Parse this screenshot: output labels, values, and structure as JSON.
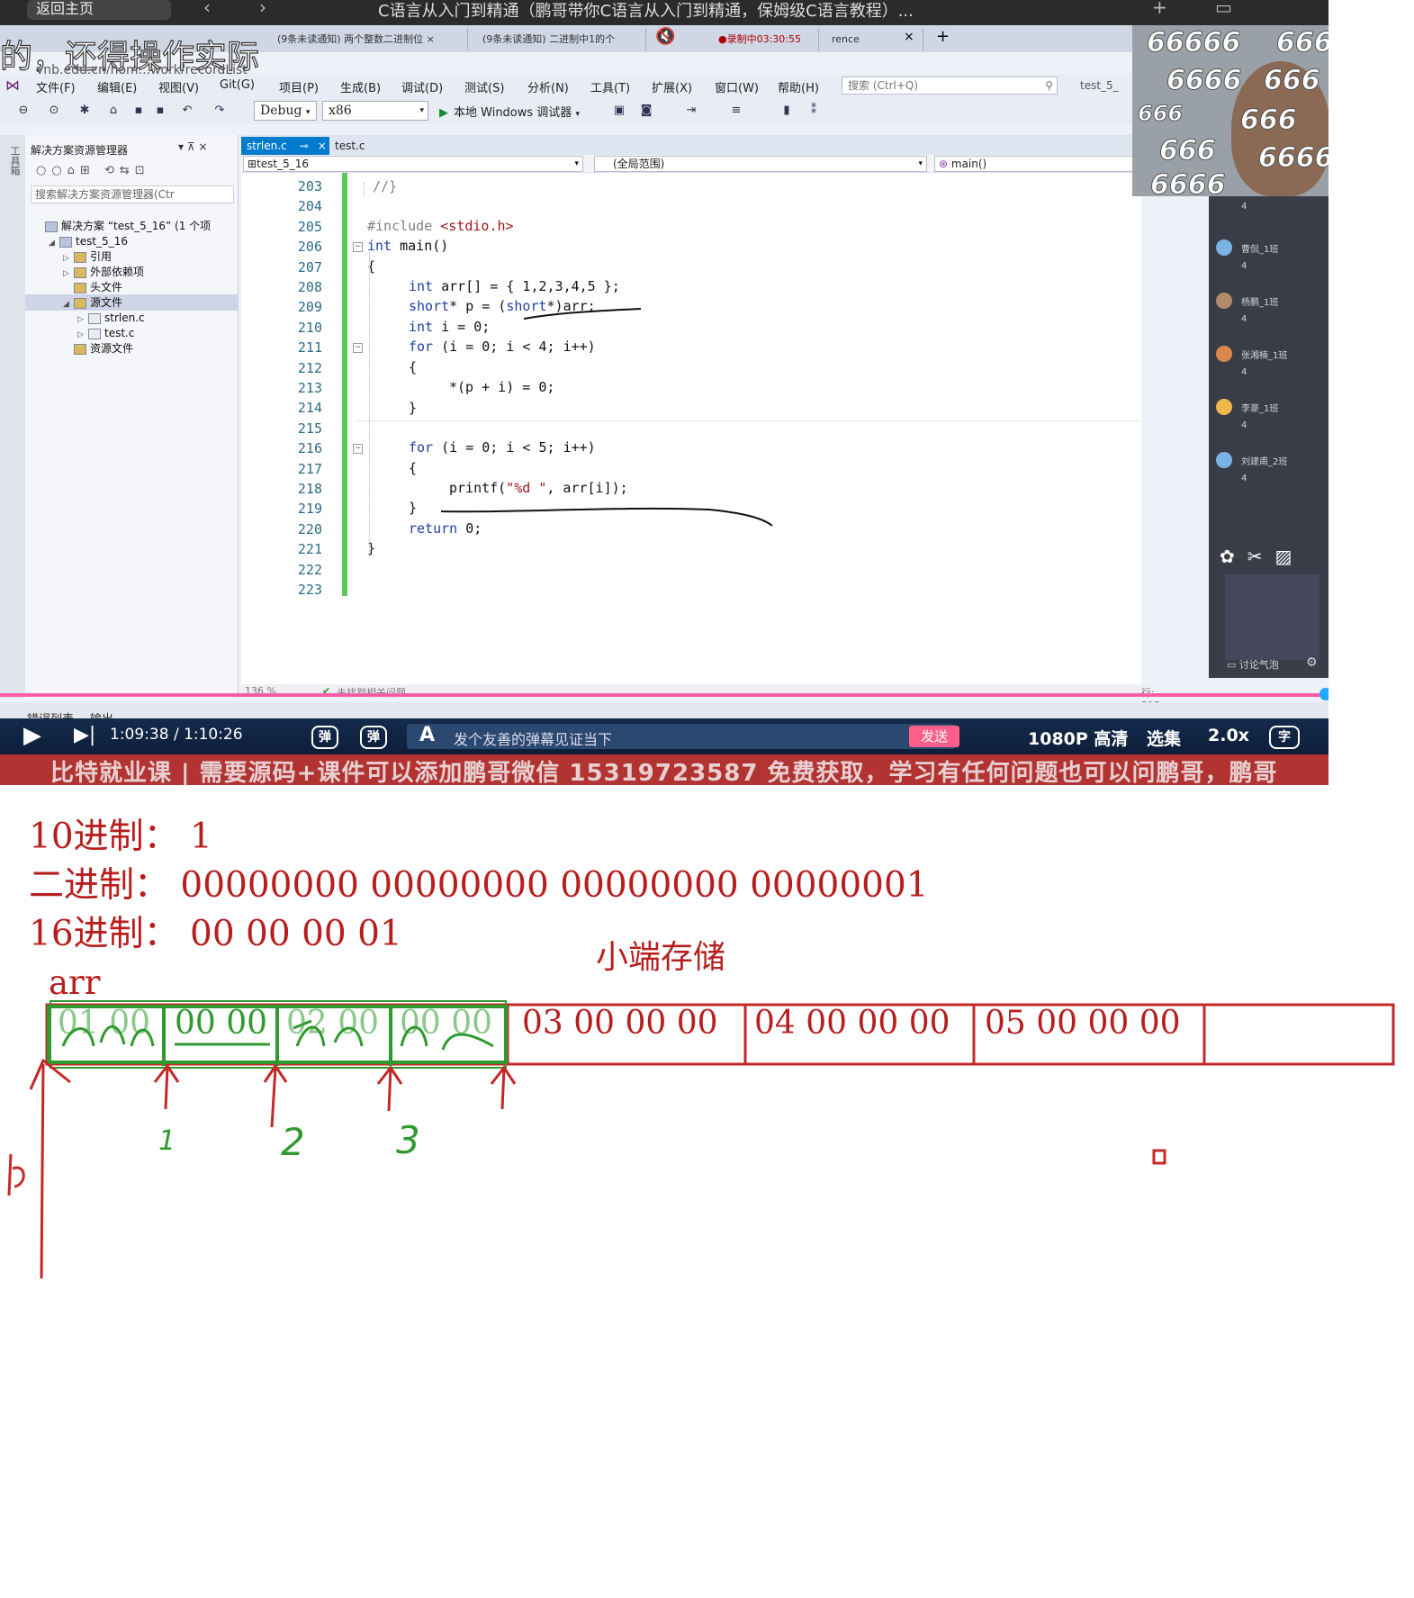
{
  "topbar": {
    "back_label": "返回主页",
    "title": "C语言从入门到精通（鹏哥带你C语言从入门到精通，保姆级C语言教程）..."
  },
  "browser_tabs": {
    "overlay_title": "的，还得操作实际",
    "overlay_sub": "ynb.edu.cn/hom...work/recordList",
    "tab1": "(9条未读通知) 两个整数二进制位 ×",
    "tab2": "(9条未读通知) 二进制中1的个",
    "tab3": "●录制中03:30:55",
    "tab4": "rence",
    "tab_close": "×",
    "tab_new": "+"
  },
  "menubar": {
    "items": [
      "文件(F)",
      "编辑(E)",
      "视图(V)",
      "Git(G)",
      "项目(P)",
      "生成(B)",
      "调试(D)",
      "测试(S)",
      "分析(N)",
      "工具(T)",
      "扩展(X)",
      "窗口(W)",
      "帮助(H)"
    ],
    "search_placeholder": "搜索 (Ctrl+Q)",
    "project_tab": "test_5_"
  },
  "toolbar": {
    "config": "Debug",
    "platform": "x86",
    "run_label": "本地 Windows 调试器"
  },
  "solution_explorer": {
    "strip_label": "工具箱",
    "title": "解决方案资源管理器",
    "search_placeholder": "搜索解决方案资源管理器(Ctr",
    "tree": [
      {
        "label": "解决方案 “test_5_16” (1 个项",
        "depth": 0,
        "caret": ""
      },
      {
        "label": "test_5_16",
        "depth": 1,
        "caret": "◢"
      },
      {
        "label": "引用",
        "depth": 2,
        "caret": "▷"
      },
      {
        "label": "外部依赖项",
        "depth": 2,
        "caret": "▷"
      },
      {
        "label": "头文件",
        "depth": 2,
        "caret": ""
      },
      {
        "label": "源文件",
        "depth": 2,
        "caret": "◢"
      },
      {
        "label": "strlen.c",
        "depth": 3,
        "caret": "▷"
      },
      {
        "label": "test.c",
        "depth": 3,
        "caret": "▷"
      },
      {
        "label": "资源文件",
        "depth": 2,
        "caret": ""
      }
    ]
  },
  "editor": {
    "tabs": [
      "strlen.c",
      "test.c"
    ],
    "nav_project": "test_5_16",
    "nav_scope": "(全局范围)",
    "nav_function": "main()",
    "zoom": "136 %",
    "status_issues": "未找到相关问题",
    "line_col": "行: 215",
    "line_numbers": [
      "203",
      "204",
      "205",
      "206",
      "207",
      "208",
      "209",
      "210",
      "211",
      "212",
      "213",
      "214",
      "215",
      "216",
      "217",
      "218",
      "219",
      "220",
      "221",
      "222",
      "223"
    ]
  },
  "output_bar": {
    "tab_errors": "错误列表",
    "tab_output": "输出"
  },
  "camera": {
    "cheers": [
      "66666",
      "666",
      "6666",
      "666",
      "666",
      "666",
      "666",
      "6666",
      "6666"
    ]
  },
  "chat": {
    "entries": [
      {
        "name": "曹侃_1班",
        "count": "4"
      },
      {
        "name": "杨鹏_1班",
        "count": "4"
      },
      {
        "name": "张湘楠_1班",
        "count": "4"
      },
      {
        "name": "李豪_1班",
        "count": "4"
      },
      {
        "name": "刘建甫_2班",
        "count": "4"
      }
    ],
    "top_count": "4",
    "footer": "讨论气泡"
  },
  "player": {
    "time": "1:09:38 / 1:10:26",
    "danmaku_placeholder": "发个友善的弹幕见证当下",
    "send": "发送",
    "quality": "1080P 高清",
    "episodes": "选集",
    "speed": "2.0x",
    "danmaku_toggle_1": "弹",
    "danmaku_toggle_2": "弹",
    "subtitle_label": "字",
    "banner": "比特就业课 | 需要源码+课件可以添加鹏哥微信 15319723587 免费获取，学习有任何问题也可以问鹏哥，鹏哥"
  },
  "whiteboard": {
    "line_decimal": "10进制：  1",
    "line_binary": "二进制：  00000000  00000000  00000000  00000001",
    "line_hex": "16进制：  00  00  00  01",
    "heading": "小端存储",
    "arr_label": "arr",
    "cells": [
      "03  00  00  00",
      "04  00  00  00",
      "05  00  00  00"
    ],
    "green_cells": [
      "01  00",
      "00  00",
      "02  00",
      "00  00"
    ],
    "marks": [
      "1",
      "2",
      "3"
    ]
  },
  "colors": {
    "board_red": "#b81e1e",
    "board_green": "#2f9a2f",
    "vs_blue": "#007acc",
    "progress_pink": "#ff5ca8"
  }
}
